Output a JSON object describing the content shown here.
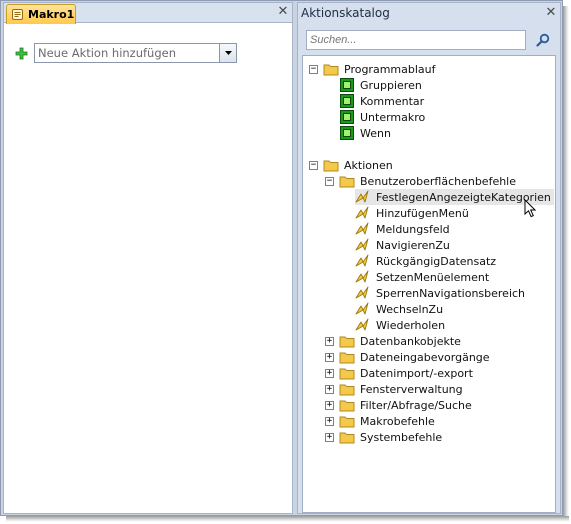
{
  "left_pane": {
    "tab_label": "Makro1",
    "close_glyph": "✕",
    "add_action_placeholder": "Neue Aktion hinzufügen"
  },
  "right_pane": {
    "title": "Aktionskatalog",
    "close_glyph": "✕",
    "search_placeholder": "Suchen..."
  },
  "tree": {
    "programmablauf": {
      "label": "Programmablauf",
      "expander": "−",
      "items": [
        "Gruppieren",
        "Kommentar",
        "Untermakro",
        "Wenn"
      ]
    },
    "aktionen": {
      "label": "Aktionen",
      "expander": "−",
      "benutzer": {
        "label": "Benutzeroberflächenbefehle",
        "expander": "−",
        "items": [
          "FestlegenAngezeigteKategorien",
          "HinzufügenMenü",
          "Meldungsfeld",
          "NavigierenZu",
          "RückgängigDatensatz",
          "SetzenMenüelement",
          "SperrenNavigationsbereich",
          "WechselnZu",
          "Wiederholen"
        ],
        "selected_index": 0
      },
      "collapsed_groups": [
        "Datenbankobjekte",
        "Dateneingabevorgänge",
        "Datenimport/-export",
        "Fensterverwaltung",
        "Filter/Abfrage/Suche",
        "Makrobefehle",
        "Systembefehle"
      ],
      "collapsed_expander": "+"
    }
  },
  "colors": {
    "tab_fill": "#ffc94a",
    "pane_background": "#d5dfed",
    "folder": "#f2c94a",
    "program_icon": "#1a9a1a",
    "action_icon": "#e8b820",
    "selected_row": "#e6e6e6"
  }
}
